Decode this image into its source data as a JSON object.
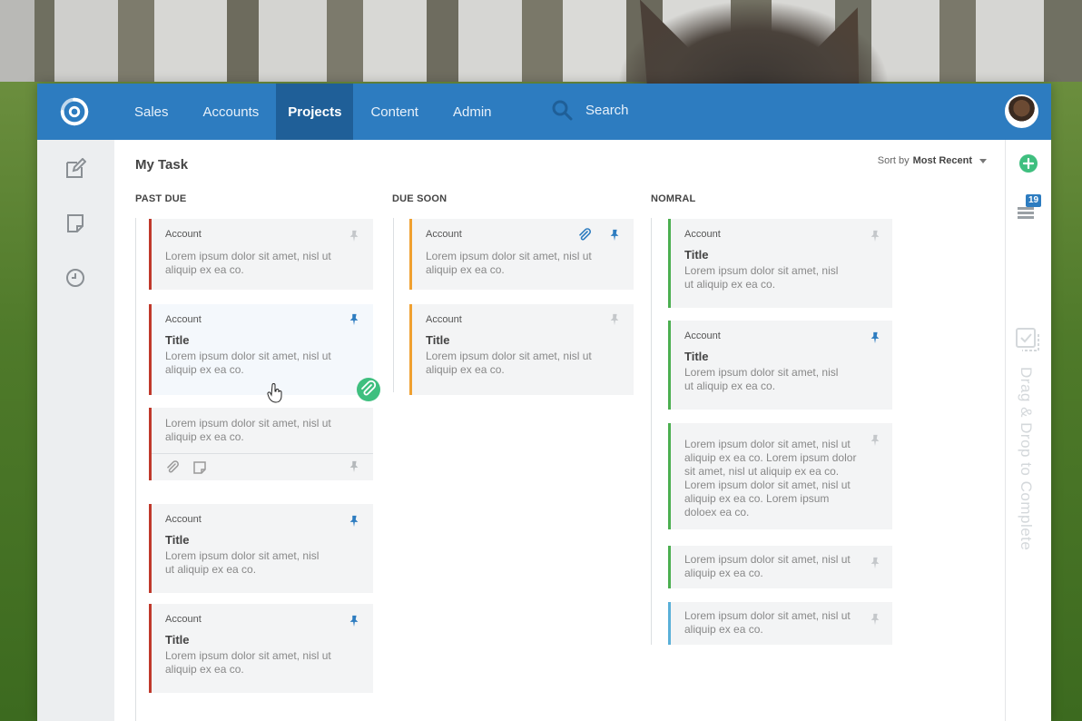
{
  "nav": {
    "items": [
      {
        "label": "Sales",
        "active": false
      },
      {
        "label": "Accounts",
        "active": false
      },
      {
        "label": "Projects",
        "active": true
      },
      {
        "label": "Content",
        "active": false
      },
      {
        "label": "Admin",
        "active": false
      }
    ],
    "search_label": "Search"
  },
  "page": {
    "title": "My Task",
    "sort_prefix": "Sort by",
    "sort_value": "Most Recent"
  },
  "columns": [
    {
      "heading": "PAST DUE"
    },
    {
      "heading": "DUE SOON"
    },
    {
      "heading": "NOMRAL"
    }
  ],
  "cards": {
    "past_due": [
      {
        "account": "Account",
        "body": "Lorem ipsum dolor sit amet, nisl ut aliquip ex ea co."
      },
      {
        "account": "Account",
        "title": "Title",
        "body": "Lorem ipsum dolor sit amet, nisl ut aliquip ex ea co."
      },
      {
        "body": "Lorem ipsum dolor sit amet, nisl ut aliquip ex ea co."
      },
      {
        "account": "Account",
        "title": "Title",
        "body": "Lorem ipsum dolor sit amet, nisl ut aliquip ex ea co."
      },
      {
        "account": "Account",
        "title": "Title",
        "body": "Lorem ipsum dolor sit amet, nisl ut aliquip ex ea co."
      }
    ],
    "due_soon": [
      {
        "account": "Account",
        "body": "Lorem ipsum dolor sit amet, nisl ut aliquip ex ea co."
      },
      {
        "account": "Account",
        "title": "Title",
        "body": "Lorem ipsum dolor sit amet, nisl ut aliquip ex ea co."
      }
    ],
    "normal": [
      {
        "account": "Account",
        "title": "Title",
        "body": "Lorem ipsum dolor sit amet, nisl ut aliquip ex ea co."
      },
      {
        "account": "Account",
        "title": "Title",
        "body": "Lorem ipsum dolor sit amet, nisl ut aliquip ex ea co."
      },
      {
        "body": "Lorem ipsum dolor sit amet, nisl ut aliquip ex ea co. Lorem ipsum dolor sit amet, nisl ut aliquip ex ea co. Lorem ipsum dolor sit amet, nisl ut aliquip ex ea co. Lorem ipsum doloex ea co."
      },
      {
        "body": "Lorem ipsum dolor sit amet, nisl ut aliquip ex ea co."
      },
      {
        "body": "Lorem ipsum dolor sit amet, nisl ut aliquip ex ea co."
      }
    ]
  },
  "right_rail": {
    "stack_badge": "19",
    "drop_label": "Drag & Drop to Complete"
  },
  "colors": {
    "brand_blue": "#2d7cc0",
    "nav_active": "#1f5f98",
    "past_due": "#c0392b",
    "due_soon": "#f0a030",
    "normal": "#4caf50",
    "info": "#5ab0d8",
    "add": "#3fbf7f"
  }
}
